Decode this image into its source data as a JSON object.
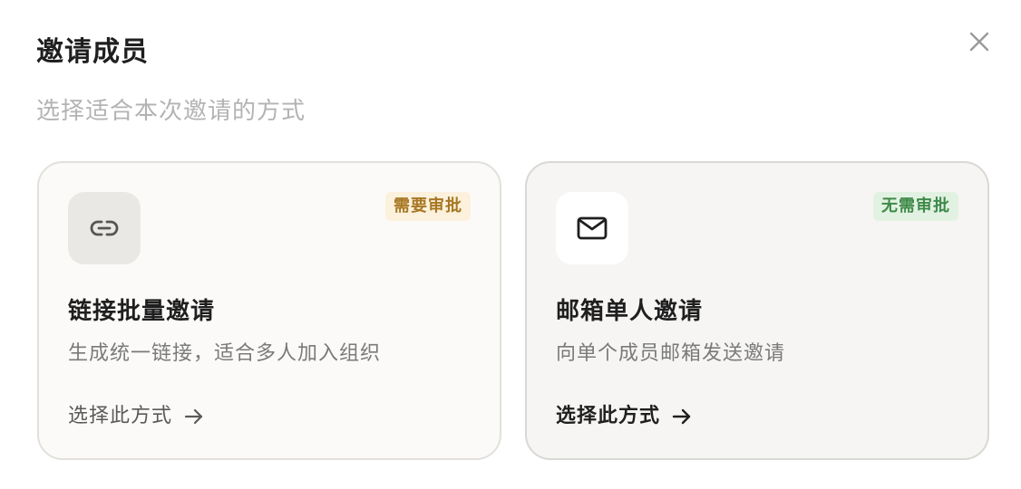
{
  "dialog": {
    "title": "邀请成员",
    "subtitle": "选择适合本次邀请的方式"
  },
  "options": [
    {
      "icon": "link-icon",
      "badge": "需要审批",
      "badge_color": "#a77722",
      "title": "链接批量邀请",
      "description": "生成统一链接，适合多人加入组织",
      "action_label": "选择此方式"
    },
    {
      "icon": "mail-icon",
      "badge": "无需审批",
      "badge_color": "#3f8a4a",
      "title": "邮箱单人邀请",
      "description": "向单个成员邮箱发送邀请",
      "action_label": "选择此方式"
    }
  ]
}
